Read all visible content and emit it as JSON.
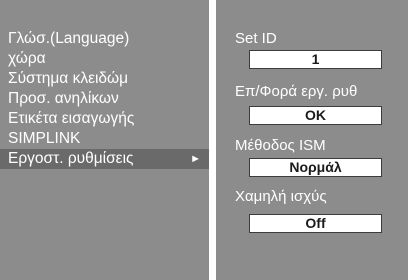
{
  "menu": {
    "items": [
      {
        "label": "Γλώσ.(Language)"
      },
      {
        "label": "χώρα"
      },
      {
        "label": "Σύστημα κλειδώμ"
      },
      {
        "label": "Προσ. ανηλίκων"
      },
      {
        "label": "Ετικέτα εισαγωγής"
      },
      {
        "label": "SIMPLINK"
      },
      {
        "label": "Εργοστ. ρυθμίσεις",
        "selected": true
      }
    ],
    "arrow": "►",
    "arrow_icon": "right-triangle-icon"
  },
  "settings": {
    "set_id": {
      "label": "Set ID",
      "value": "1"
    },
    "factory_setup": {
      "label": "Επ/Φορά εργ. ρυθ",
      "value": "OK"
    },
    "ism_method": {
      "label": "Μέθοδος ISM",
      "value": "Νορμάλ"
    },
    "low_power": {
      "label": "Χαμηλή ισχύς",
      "value": "Off"
    }
  },
  "colors": {
    "panel": "#8c8c8c",
    "highlight": "#6a6a6a",
    "divider": "#ffffff",
    "text": "#ffffff"
  }
}
